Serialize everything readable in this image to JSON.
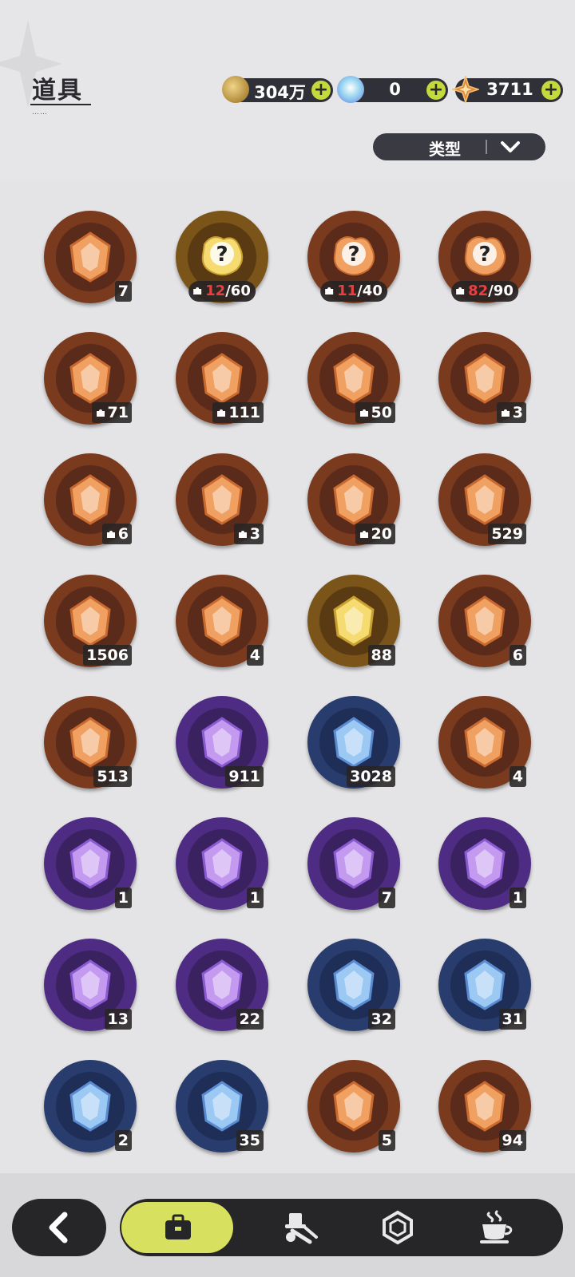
{
  "header": {
    "title": "道具",
    "title_dots": "……",
    "currencies": [
      {
        "icon": "gold-coin-icon",
        "value": "304万",
        "color": "#c9a24a"
      },
      {
        "icon": "crystal-icon",
        "value": "0",
        "color": "#9ad6f0"
      },
      {
        "icon": "star-gem-icon",
        "value": "3711",
        "color": "#e08a3c"
      }
    ],
    "plus_label": "+"
  },
  "filter": {
    "label": "类型"
  },
  "items": [
    {
      "icon": "purple-crystal-card-icon",
      "rarity": "orange",
      "count": "7"
    },
    {
      "icon": "mystery-puzzle-gold-icon",
      "rarity": "gold",
      "frag_have": "12",
      "frag_need": "/60"
    },
    {
      "icon": "mystery-puzzle-orange-icon",
      "rarity": "orange",
      "frag_have": "11",
      "frag_need": "/40"
    },
    {
      "icon": "mystery-puzzle-brown-icon",
      "rarity": "orange",
      "frag_have": "82",
      "frag_need": "/90"
    },
    {
      "icon": "bear-puzzle-icon",
      "rarity": "orange",
      "count": "71",
      "fragment": true
    },
    {
      "icon": "knight-puzzle-icon",
      "rarity": "orange",
      "count": "111",
      "fragment": true
    },
    {
      "icon": "cat-puzzle-icon",
      "rarity": "orange",
      "count": "50",
      "fragment": true
    },
    {
      "icon": "panda-puzzle-icon",
      "rarity": "orange",
      "count": "3",
      "fragment": true
    },
    {
      "icon": "dark-bear-puzzle-icon",
      "rarity": "orange",
      "count": "6",
      "fragment": true
    },
    {
      "icon": "purple-creature-puzzle-icon",
      "rarity": "orange",
      "count": "3",
      "fragment": true
    },
    {
      "icon": "tiger-puzzle-icon",
      "rarity": "orange",
      "count": "20",
      "fragment": true
    },
    {
      "icon": "pink-star-crystal-icon",
      "rarity": "orange",
      "count": "529"
    },
    {
      "icon": "blue-star-crystal-icon",
      "rarity": "orange",
      "count": "1506"
    },
    {
      "icon": "paw-charm-icon",
      "rarity": "orange",
      "count": "4"
    },
    {
      "icon": "gold-character-card-icon",
      "rarity": "gold",
      "count": "88"
    },
    {
      "icon": "rainbow-character-card-icon",
      "rarity": "orange",
      "count": "6"
    },
    {
      "icon": "orange-character-card-icon",
      "rarity": "orange",
      "count": "513"
    },
    {
      "icon": "purple-character-card-icon",
      "rarity": "purple",
      "count": "911"
    },
    {
      "icon": "blue-character-card-icon",
      "rarity": "blue",
      "count": "3028"
    },
    {
      "icon": "clover-card-icon",
      "rarity": "orange",
      "count": "4"
    },
    {
      "icon": "golden-horns-icon",
      "rarity": "purple",
      "count": "1"
    },
    {
      "icon": "gift-box-icon",
      "rarity": "purple",
      "count": "1"
    },
    {
      "icon": "golden-helmet-icon",
      "rarity": "purple",
      "count": "7"
    },
    {
      "icon": "magic-mirror-icon",
      "rarity": "purple",
      "count": "1"
    },
    {
      "icon": "scroll-icon",
      "rarity": "purple",
      "count": "13"
    },
    {
      "icon": "pink-apple-icon",
      "rarity": "purple",
      "count": "22"
    },
    {
      "icon": "shovel-icon",
      "rarity": "blue",
      "count": "32"
    },
    {
      "icon": "gauntlet-icon",
      "rarity": "blue",
      "count": "31"
    },
    {
      "icon": "pickaxe-icon",
      "rarity": "blue",
      "count": "2"
    },
    {
      "icon": "hammer-icon",
      "rarity": "blue",
      "count": "35"
    },
    {
      "icon": "golden-key-icon",
      "rarity": "orange",
      "count": "5"
    },
    {
      "icon": "ruby-heart-icon",
      "rarity": "orange",
      "count": "94"
    }
  ],
  "nav": {
    "back": "back-arrow-icon",
    "tabs": [
      {
        "icon": "briefcase-icon",
        "active": true
      },
      {
        "icon": "hat-and-tools-icon",
        "active": false
      },
      {
        "icon": "hexagon-gem-icon",
        "active": false
      },
      {
        "icon": "cup-icon",
        "active": false
      }
    ]
  },
  "colors": {
    "orange_ring": "#e6762a",
    "gold_ring": "#f2c630",
    "purple_ring": "#9a56e0",
    "blue_ring": "#4a8ee0",
    "active_tab": "#d8e060"
  }
}
